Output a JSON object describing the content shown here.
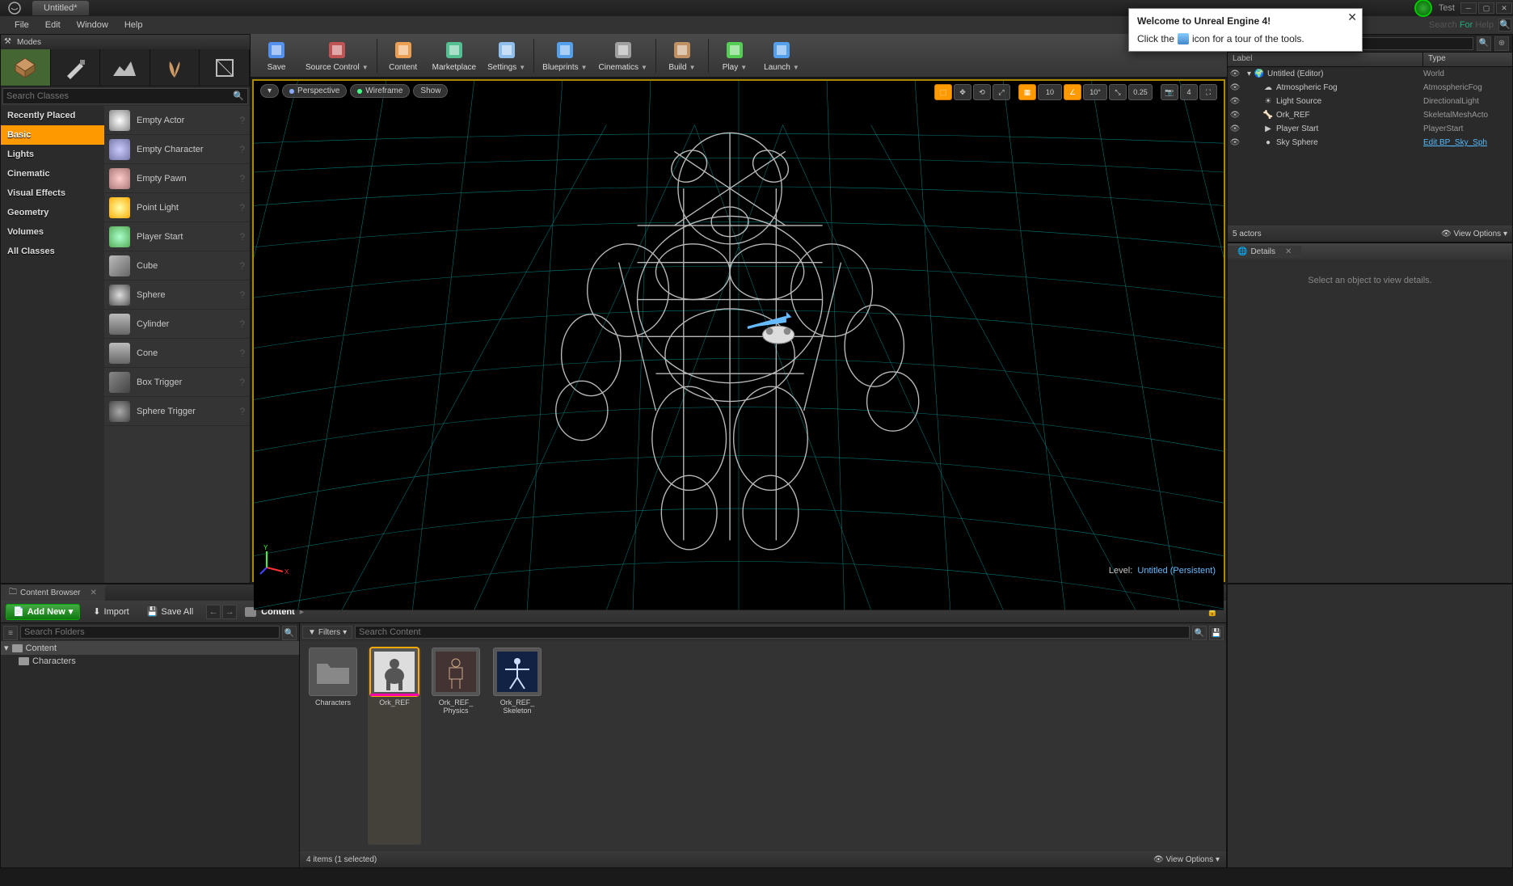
{
  "titlebar": {
    "tab": "Untitled*",
    "project": "Test"
  },
  "menu": [
    "File",
    "Edit",
    "Window",
    "Help"
  ],
  "searchHelp": {
    "placeholder": "Search For Help"
  },
  "modes": {
    "title": "Modes",
    "searchPlaceholder": "Search Classes",
    "categories": [
      "Recently Placed",
      "Basic",
      "Lights",
      "Cinematic",
      "Visual Effects",
      "Geometry",
      "Volumes",
      "All Classes"
    ],
    "activeCategory": "Basic",
    "items": [
      "Empty Actor",
      "Empty Character",
      "Empty Pawn",
      "Point Light",
      "Player Start",
      "Cube",
      "Sphere",
      "Cylinder",
      "Cone",
      "Box Trigger",
      "Sphere Trigger"
    ]
  },
  "toolbar": [
    {
      "label": "Save",
      "caret": false
    },
    {
      "label": "Source Control",
      "caret": true
    },
    {
      "sep": true
    },
    {
      "label": "Content",
      "caret": false
    },
    {
      "label": "Marketplace",
      "caret": false
    },
    {
      "label": "Settings",
      "caret": true
    },
    {
      "sep": true
    },
    {
      "label": "Blueprints",
      "caret": true
    },
    {
      "label": "Cinematics",
      "caret": true
    },
    {
      "sep": true
    },
    {
      "label": "Build",
      "caret": true
    },
    {
      "sep": true
    },
    {
      "label": "Play",
      "caret": true
    },
    {
      "label": "Launch",
      "caret": true
    }
  ],
  "viewport": {
    "left": [
      "Perspective",
      "Wireframe",
      "Show"
    ],
    "snap1": "10",
    "snap2": "10°",
    "snap3": "0.25",
    "camspeed": "4",
    "level": "Level:",
    "levelName": "Untitled (Persistent)"
  },
  "outliner": {
    "headers": {
      "label": "Label",
      "type": "Type"
    },
    "rows": [
      {
        "indent": 0,
        "label": "Untitled (Editor)",
        "type": "World",
        "arrow": true,
        "icon": "world"
      },
      {
        "indent": 1,
        "label": "Atmospheric Fog",
        "type": "AtmosphericFog",
        "icon": "fog"
      },
      {
        "indent": 1,
        "label": "Light Source",
        "type": "DirectionalLight",
        "icon": "light"
      },
      {
        "indent": 1,
        "label": "Ork_REF",
        "type": "SkeletalMeshActo",
        "icon": "skel"
      },
      {
        "indent": 1,
        "label": "Player Start",
        "type": "PlayerStart",
        "icon": "player"
      },
      {
        "indent": 1,
        "label": "Sky Sphere",
        "type": "",
        "icon": "sphere",
        "link": "Edit BP_Sky_Sph"
      }
    ],
    "footer": "5 actors",
    "viewOpts": "View Options"
  },
  "details": {
    "tab": "Details",
    "empty": "Select an object to view details."
  },
  "contentBrowser": {
    "tab": "Content Browser",
    "addNew": "Add New",
    "import": "Import",
    "saveAll": "Save All",
    "crumb": "Content",
    "filters": "Filters",
    "searchFolders": "Search Folders",
    "searchContent": "Search Content",
    "tree": {
      "root": "Content",
      "children": [
        "Characters"
      ]
    },
    "assets": [
      {
        "label": "Characters",
        "type": "folder"
      },
      {
        "label": "Ork_REF",
        "type": "skeletal",
        "selected": true
      },
      {
        "label": "Ork_REF_\nPhysics",
        "type": "physics"
      },
      {
        "label": "Ork_REF_\nSkeleton",
        "type": "skeleton"
      }
    ],
    "footer": "4 items (1 selected)",
    "viewOpts": "View Options"
  },
  "welcome": {
    "title": "Welcome to Unreal Engine 4!",
    "hint1": "Click the",
    "hint2": "icon for a tour of the tools."
  }
}
